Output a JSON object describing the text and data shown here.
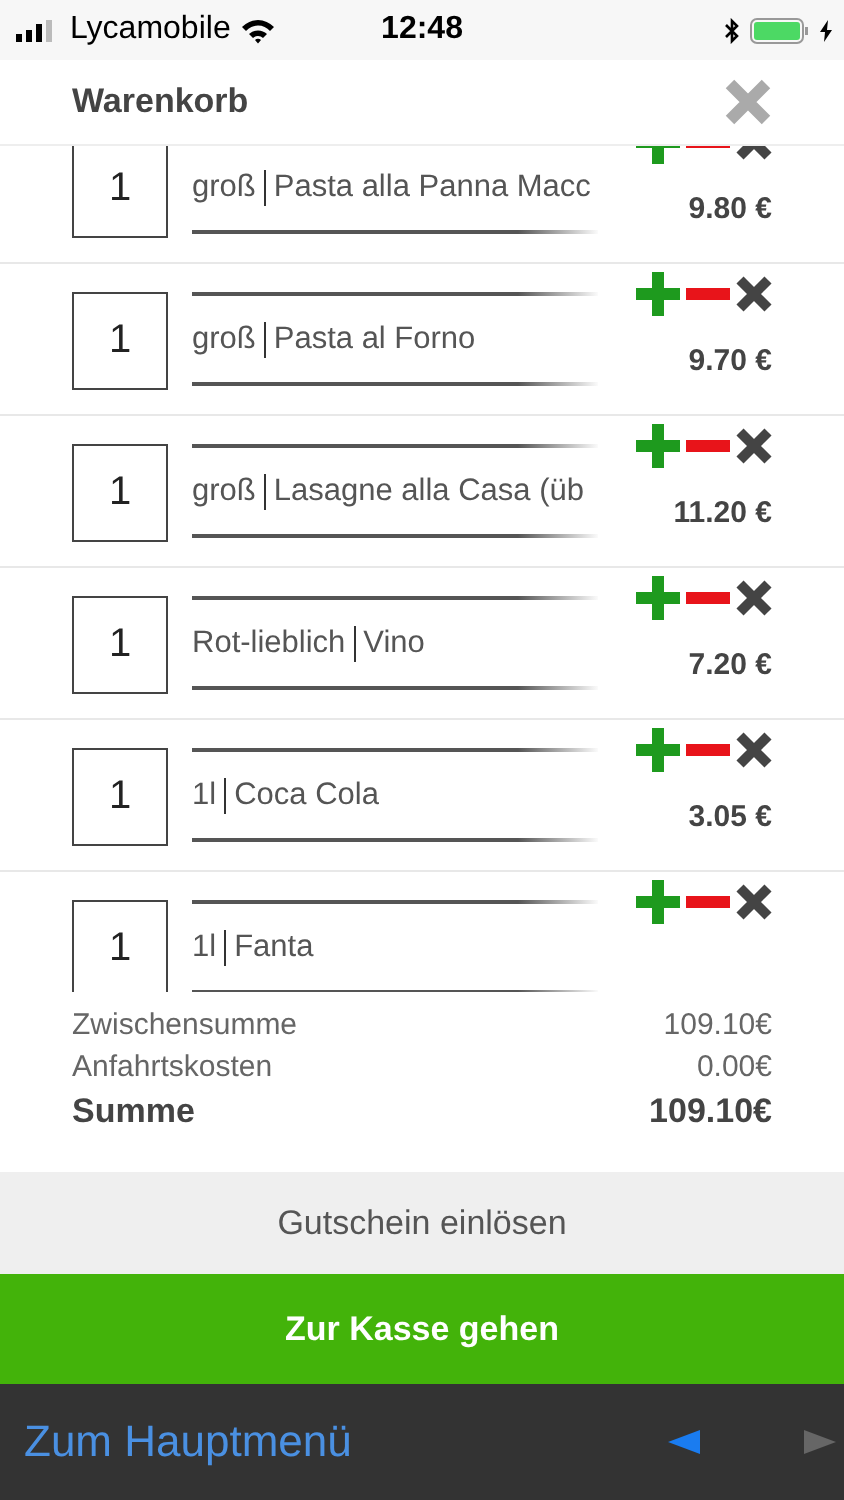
{
  "status_bar": {
    "carrier": "Lycamobile",
    "time": "12:48"
  },
  "header": {
    "title": "Warenkorb"
  },
  "items": [
    {
      "quantity": "1",
      "size": "groß",
      "name": "Pasta alla Panna Macc",
      "price": "9.80 €"
    },
    {
      "quantity": "1",
      "size": "groß",
      "name": "Pasta al Forno",
      "price": "9.70 €"
    },
    {
      "quantity": "1",
      "size": "groß",
      "name": "Lasagne alla Casa (üb",
      "price": "11.20 €"
    },
    {
      "quantity": "1",
      "size": "Rot-lieblich",
      "name": "Vino",
      "price": "7.20 €"
    },
    {
      "quantity": "1",
      "size": "1l",
      "name": "Coca Cola",
      "price": "3.05 €"
    },
    {
      "quantity": "1",
      "size": "1l",
      "name": "Fanta"
    }
  ],
  "summary": [
    {
      "label": "Zwischensumme",
      "value": "109.10€",
      "kind": "normal"
    },
    {
      "label": "Anfahrtskosten",
      "value": "0.00€",
      "kind": "normal"
    },
    {
      "label": "Summe",
      "value": "109.10€",
      "kind": "total"
    }
  ],
  "voucher_button": "Gutschein einlösen",
  "checkout_button": "Zur Kasse gehen",
  "bottom_bar": {
    "link": "Zum Hauptmenü"
  }
}
